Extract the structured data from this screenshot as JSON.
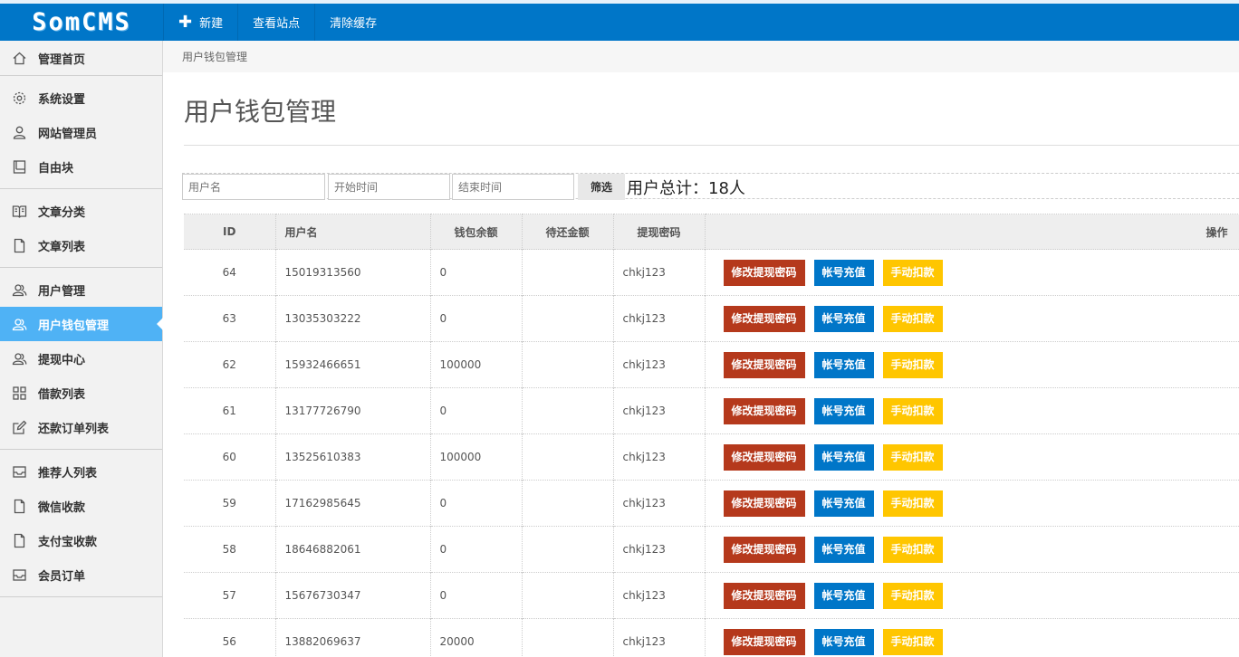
{
  "logo": "SomCMS",
  "topnav": [
    {
      "label": "新建",
      "has_plus": true
    },
    {
      "label": "查看站点",
      "has_plus": false
    },
    {
      "label": "清除缓存",
      "has_plus": false
    }
  ],
  "sidebar": {
    "groups": [
      [
        {
          "label": "管理首页",
          "icon": "home-icon",
          "active": false
        }
      ],
      [
        {
          "label": "系统设置",
          "icon": "gear-icon",
          "active": false
        },
        {
          "label": "网站管理员",
          "icon": "user-icon",
          "active": false
        },
        {
          "label": "自由块",
          "icon": "book-icon",
          "active": false
        }
      ],
      [
        {
          "label": "文章分类",
          "icon": "open-book-icon",
          "active": false
        },
        {
          "label": "文章列表",
          "icon": "file-icon",
          "active": false
        }
      ],
      [
        {
          "label": "用户管理",
          "icon": "users-icon",
          "active": false
        },
        {
          "label": "用户钱包管理",
          "icon": "users-icon",
          "active": true
        },
        {
          "label": "提现中心",
          "icon": "users-icon",
          "active": false
        },
        {
          "label": "借款列表",
          "icon": "grid-icon",
          "active": false
        },
        {
          "label": "还款订单列表",
          "icon": "edit-icon",
          "active": false
        }
      ],
      [
        {
          "label": "推荐人列表",
          "icon": "inbox-icon",
          "active": false
        },
        {
          "label": "微信收款",
          "icon": "file-icon",
          "active": false
        },
        {
          "label": "支付宝收款",
          "icon": "file-icon",
          "active": false
        },
        {
          "label": "会员订单",
          "icon": "inbox-icon",
          "active": false
        }
      ]
    ]
  },
  "breadcrumb": "用户钱包管理",
  "page_title": "用户钱包管理",
  "filter": {
    "username_placeholder": "用户名",
    "start_placeholder": "开始时间",
    "end_placeholder": "结束时间",
    "filter_label": "筛选",
    "total_text": "用户总计：18人"
  },
  "table": {
    "columns": [
      "ID",
      "用户名",
      "钱包余额",
      "待还金额",
      "提现密码",
      "操作"
    ],
    "actions": [
      "修改提现密码",
      "帐号充值",
      "手动扣款"
    ],
    "rows": [
      {
        "id": "64",
        "username": "15019313560",
        "balance": "0",
        "pending": "",
        "password": "chkj123"
      },
      {
        "id": "63",
        "username": "13035303222",
        "balance": "0",
        "pending": "",
        "password": "chkj123"
      },
      {
        "id": "62",
        "username": "15932466651",
        "balance": "100000",
        "pending": "",
        "password": "chkj123"
      },
      {
        "id": "61",
        "username": "13177726790",
        "balance": "0",
        "pending": "",
        "password": "chkj123"
      },
      {
        "id": "60",
        "username": "13525610383",
        "balance": "100000",
        "pending": "",
        "password": "chkj123"
      },
      {
        "id": "59",
        "username": "17162985645",
        "balance": "0",
        "pending": "",
        "password": "chkj123"
      },
      {
        "id": "58",
        "username": "18646882061",
        "balance": "0",
        "pending": "",
        "password": "chkj123"
      },
      {
        "id": "57",
        "username": "15676730347",
        "balance": "0",
        "pending": "",
        "password": "chkj123"
      },
      {
        "id": "56",
        "username": "13882069637",
        "balance": "20000",
        "pending": "",
        "password": "chkj123"
      }
    ]
  },
  "colors": {
    "topbar": "#0076c8",
    "active_nav": "#4fb2f5",
    "btn_red": "#b5391c",
    "btn_blue": "#0076c8",
    "btn_yellow": "#ffc600"
  }
}
